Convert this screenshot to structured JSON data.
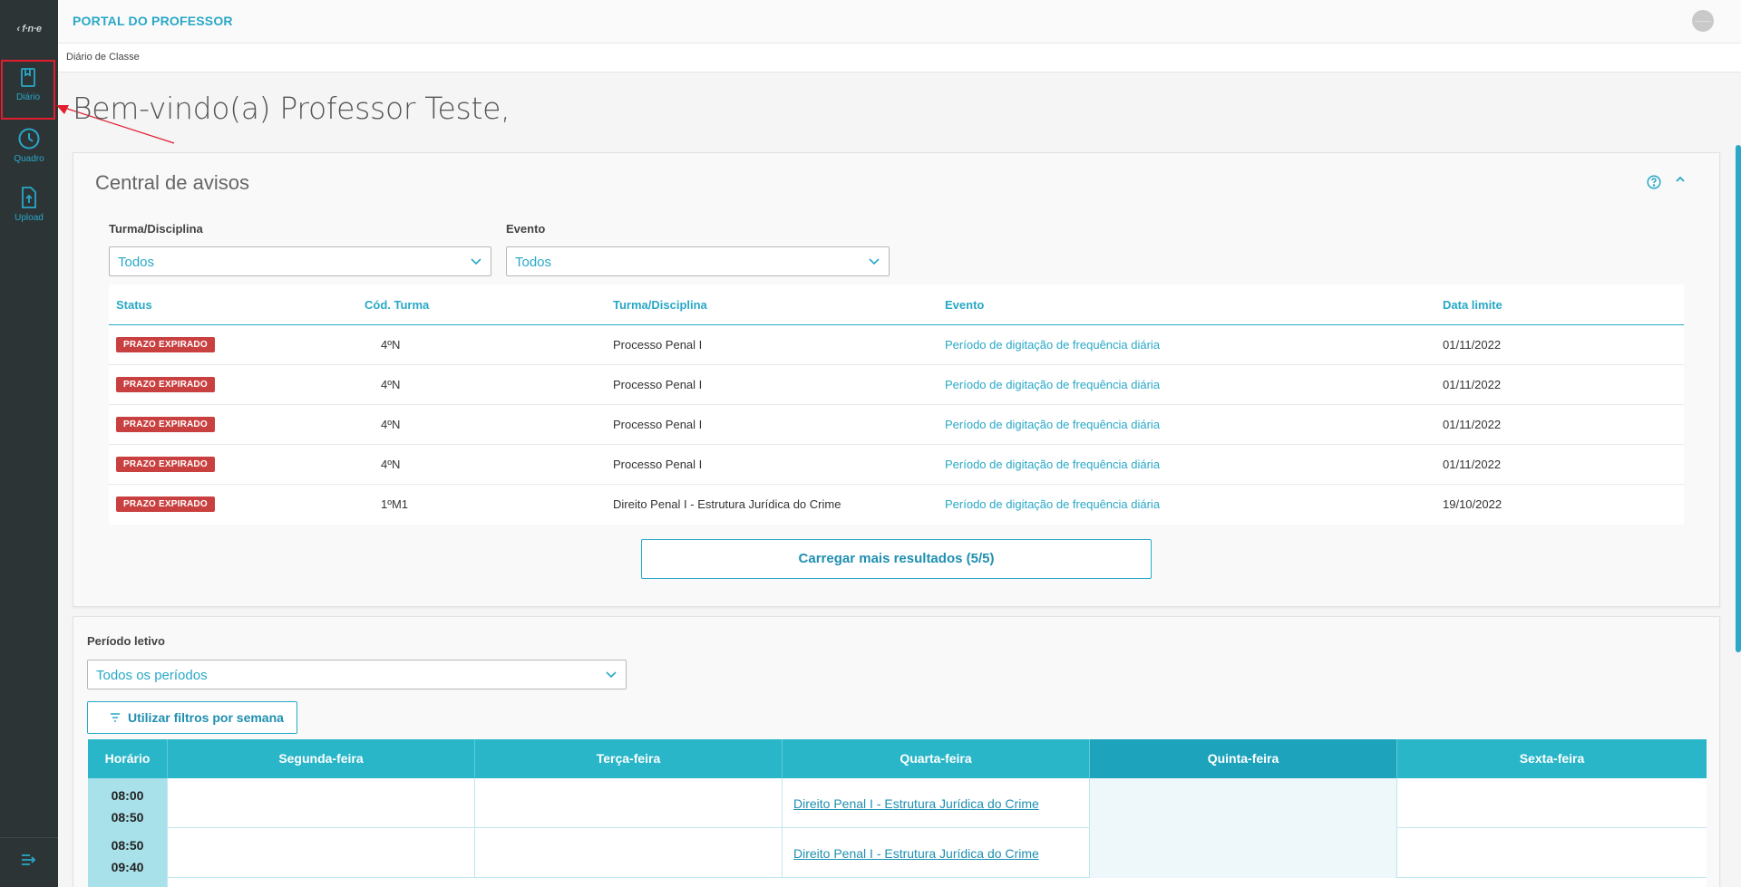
{
  "sidebar": {
    "logo": "‹ f·n·e",
    "items": [
      {
        "label": "Diário",
        "icon": "book-icon"
      },
      {
        "label": "Quadro",
        "icon": "clock-icon"
      },
      {
        "label": "Upload",
        "icon": "upload-icon"
      }
    ],
    "bottom_icon": "expand-menu-icon"
  },
  "header": {
    "title": "PORTAL DO PROFESSOR",
    "avatar_text": "——"
  },
  "breadcrumb": "Diário de Classe",
  "welcome": "Bem-vindo(a) Professor Teste,",
  "notices": {
    "title": "Central de avisos",
    "filters": {
      "turma_label": "Turma/Disciplina",
      "turma_value": "Todos",
      "evento_label": "Evento",
      "evento_value": "Todos"
    },
    "columns": [
      "Status",
      "Cód. Turma",
      "Turma/Disciplina",
      "Evento",
      "Data limite"
    ],
    "rows": [
      {
        "status": "PRAZO EXPIRADO",
        "code": "4ºN",
        "subject": "Processo Penal I",
        "event": "Período de digitação de frequência diária",
        "deadline": "01/11/2022"
      },
      {
        "status": "PRAZO EXPIRADO",
        "code": "4ºN",
        "subject": "Processo Penal I",
        "event": "Período de digitação de frequência diária",
        "deadline": "01/11/2022"
      },
      {
        "status": "PRAZO EXPIRADO",
        "code": "4ºN",
        "subject": "Processo Penal I",
        "event": "Período de digitação de frequência diária",
        "deadline": "01/11/2022"
      },
      {
        "status": "PRAZO EXPIRADO",
        "code": "4ºN",
        "subject": "Processo Penal I",
        "event": "Período de digitação de frequência diária",
        "deadline": "01/11/2022"
      },
      {
        "status": "PRAZO EXPIRADO",
        "code": "1ºM1",
        "subject": "Direito Penal I - Estrutura Jurídica do Crime",
        "event": "Período de digitação de frequência diária",
        "deadline": "19/10/2022"
      }
    ],
    "load_more": "Carregar mais resultados (5/5)"
  },
  "schedule": {
    "period_label": "Período letivo",
    "period_value": "Todos os períodos",
    "week_filter_button": "Utilizar filtros por semana",
    "columns": [
      "Horário",
      "Segunda-feira",
      "Terça-feira",
      "Quarta-feira",
      "Quinta-feira",
      "Sexta-feira"
    ],
    "rows": [
      {
        "start": "08:00",
        "end": "08:50",
        "monday": "",
        "tuesday": "",
        "wednesday": "Direito Penal I - Estrutura Jurídica do Crime",
        "thursday": "",
        "friday": ""
      },
      {
        "start": "08:50",
        "end": "09:40",
        "monday": "",
        "tuesday": "",
        "wednesday": "Direito Penal I - Estrutura Jurídica do Crime",
        "thursday": "",
        "friday": ""
      }
    ]
  },
  "colors": {
    "accent": "#29a8c7",
    "sidebar": "#2c3436",
    "expired": "#c94040",
    "schedule_header": "#29b6c9"
  }
}
